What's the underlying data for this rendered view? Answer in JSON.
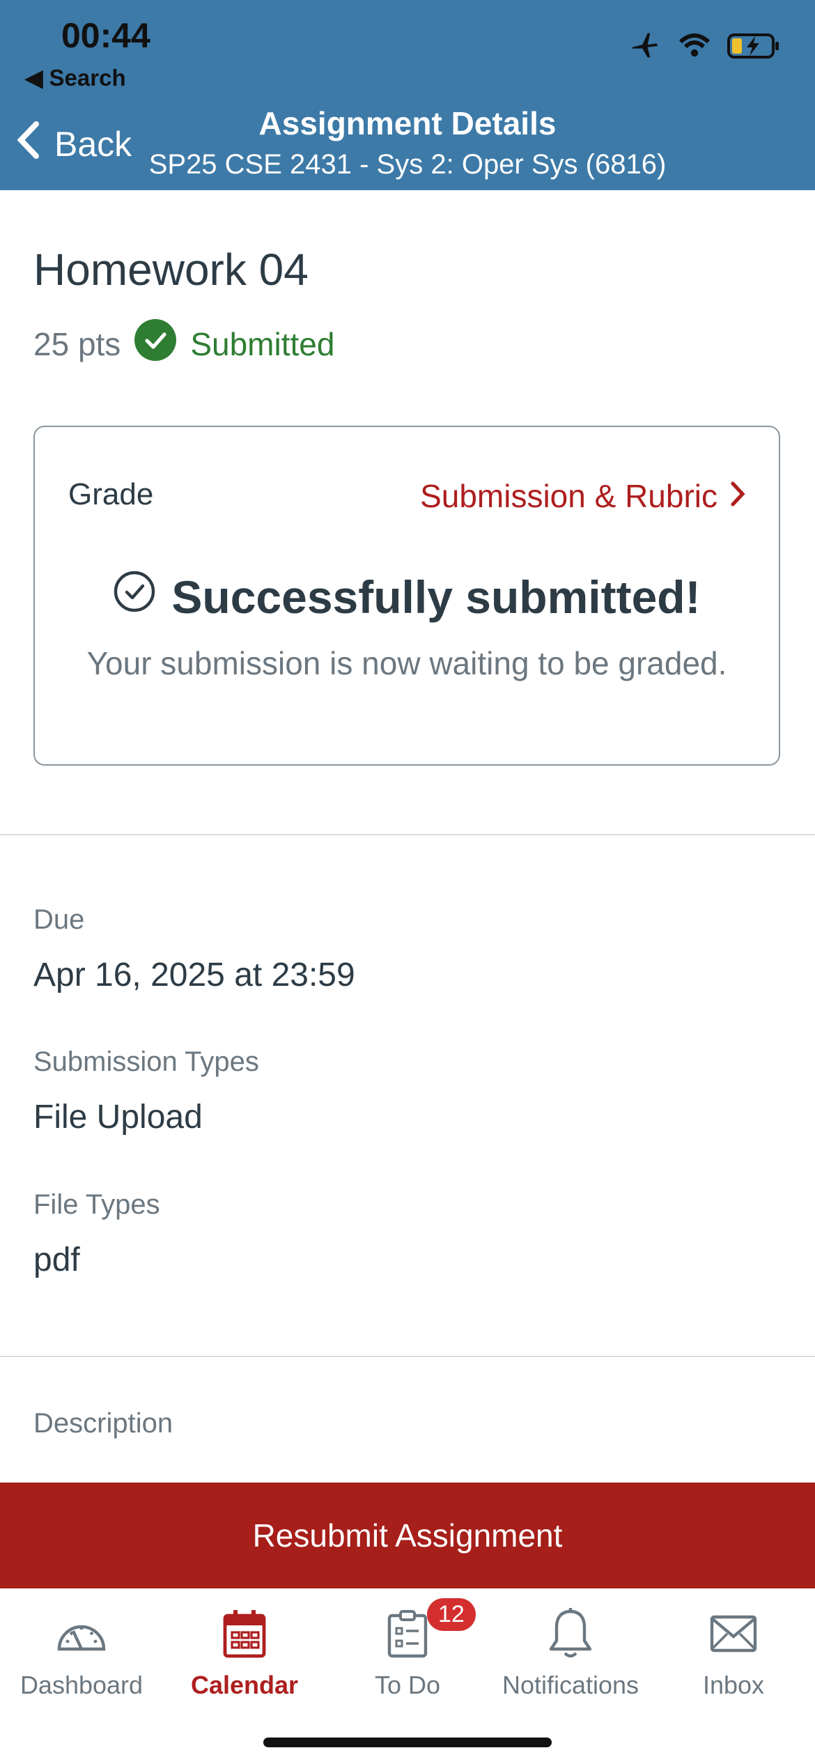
{
  "status_bar": {
    "time": "00:44",
    "back_app": "Search"
  },
  "nav": {
    "back_label": "Back",
    "title": "Assignment Details",
    "subtitle": "SP25 CSE 2431 - Sys 2: Oper Sys (6816)"
  },
  "assignment": {
    "title": "Homework 04",
    "points": "25 pts",
    "status": "Submitted"
  },
  "grade_card": {
    "label": "Grade",
    "link": "Submission & Rubric",
    "success_title": "Successfully submitted!",
    "success_sub": "Your submission is now waiting to be graded."
  },
  "details": {
    "due_label": "Due",
    "due_value": "Apr 16, 2025 at 23:59",
    "submission_types_label": "Submission Types",
    "submission_types_value": "File Upload",
    "file_types_label": "File Types",
    "file_types_value": "pdf",
    "description_label": "Description"
  },
  "resubmit_label": "Resubmit Assignment",
  "tabs": [
    {
      "label": "Dashboard",
      "icon": "dashboard-icon"
    },
    {
      "label": "Calendar",
      "icon": "calendar-icon",
      "active": true
    },
    {
      "label": "To Do",
      "icon": "todo-icon",
      "badge": "12"
    },
    {
      "label": "Notifications",
      "icon": "bell-icon"
    },
    {
      "label": "Inbox",
      "icon": "mail-icon"
    }
  ],
  "colors": {
    "header": "#3d7aa8",
    "accent": "#ae1e1e",
    "success": "#2e7d32",
    "resubmit": "#a61f1a"
  }
}
